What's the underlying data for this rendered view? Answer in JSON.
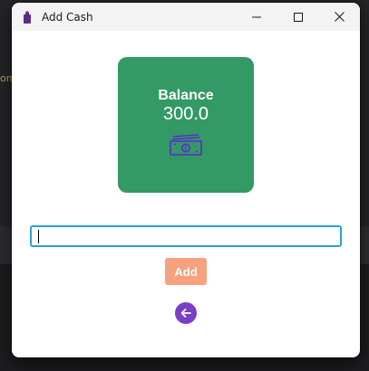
{
  "background": {
    "partial_text": "om"
  },
  "window": {
    "title": "Add Cash",
    "controls": {
      "minimize": "minimize-icon",
      "maximize": "maximize-icon",
      "close": "close-icon"
    }
  },
  "balance": {
    "label": "Balance",
    "value": "300.0",
    "icon": "cash-icon",
    "card_color": "#339965"
  },
  "amount_input": {
    "value": "",
    "placeholder": ""
  },
  "add_button": {
    "label": "Add",
    "color": "#f7a27e"
  },
  "back_button": {
    "icon": "back-arrow-icon",
    "color": "#7a3fc6"
  }
}
